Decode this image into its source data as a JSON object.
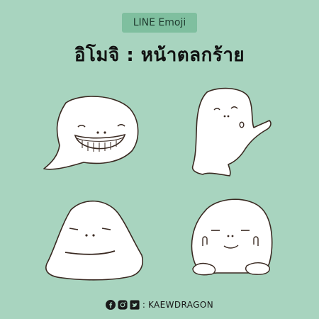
{
  "badge": {
    "label": "LINE Emoji"
  },
  "title": "อิโมจิ : หน้าตลกร้าย",
  "emojis": [
    {
      "name": "grinning-ghost"
    },
    {
      "name": "waving-ghost"
    },
    {
      "name": "flat-mouth-blob"
    },
    {
      "name": "smirk-blob-hands"
    }
  ],
  "footer": {
    "separator": ":",
    "handle": "KAEWDRAGON",
    "icons": [
      "facebook-icon",
      "instagram-icon",
      "twitter-icon"
    ]
  },
  "colors": {
    "background": "#a8d4bf",
    "badge": "#7fbf9f",
    "ink": "#3a2a22",
    "fill": "#ffffff"
  }
}
